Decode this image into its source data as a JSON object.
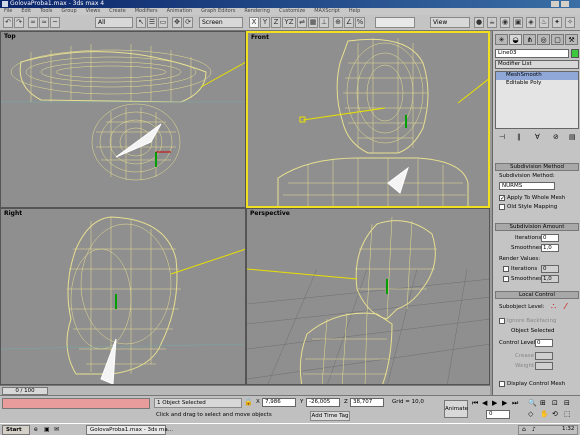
{
  "window": {
    "title": "GolovaProba1.max - 3ds max 4"
  },
  "menu": [
    "File",
    "Edit",
    "Tools",
    "Group",
    "Views",
    "Create",
    "Modifiers",
    "Animation",
    "Graph Editors",
    "Rendering",
    "Customize",
    "MAXScript",
    "Help"
  ],
  "toolbar": {
    "selection_filter": "All",
    "ref_coord": "Screen",
    "axis_x": "X",
    "axis_y": "Y",
    "axis_z": "Z",
    "axis_yz": "YZ",
    "axis_xy": "XY",
    "named_sel": "View"
  },
  "viewports": {
    "top": {
      "label": "Top"
    },
    "front": {
      "label": "Front"
    },
    "right": {
      "label": "Right"
    },
    "perspective": {
      "label": "Perspective"
    }
  },
  "panel": {
    "object_name": "Line03",
    "modifier_list": "Modifier List",
    "stack": [
      "MeshSmooth",
      "Editable Poly"
    ],
    "subdivision_method_rollout": "Subdivision Method",
    "subdivision_method_label": "Subdivision Method:",
    "subdivision_method_value": "NURMS",
    "apply_whole_mesh": "Apply To Whole Mesh",
    "old_style_mapping": "Old Style Mapping",
    "subdivision_amount_rollout": "Subdivision Amount",
    "iterations_label": "Iterations:",
    "iterations_value": "0",
    "smoothness_label": "Smoothness:",
    "smoothness_value": "1,0",
    "render_values": "Render Values:",
    "r_iterations_label": "Iterations",
    "r_iterations_value": "0",
    "r_smoothness_label": "Smoothness",
    "r_smoothness_value": "1,0",
    "local_control_rollout": "Local Control",
    "subobject_level": "Subobject Level:",
    "ignore_backfacing": "Ignore Backfacing",
    "object_selected": "Object Selected",
    "control_level_label": "Control Level:",
    "control_level_value": "0",
    "crease_label": "Crease",
    "weight_label": "Weight",
    "display_control_mesh": "Display Control Mesh"
  },
  "status": {
    "timeslider": "0 / 100",
    "selected": "1 Object Selected",
    "prompt": "Click and drag to select and move objects",
    "x_value": "7,986",
    "y_value": "-26,005",
    "z_value": "38,707",
    "grid": "Grid = 10,0",
    "add_time_tag": "Add Time Tag",
    "animate": "Animate",
    "frame": "0"
  },
  "taskbar": {
    "start": "Start",
    "task": "GolovaProba1.max - 3ds ma...",
    "clock": "1:32"
  }
}
